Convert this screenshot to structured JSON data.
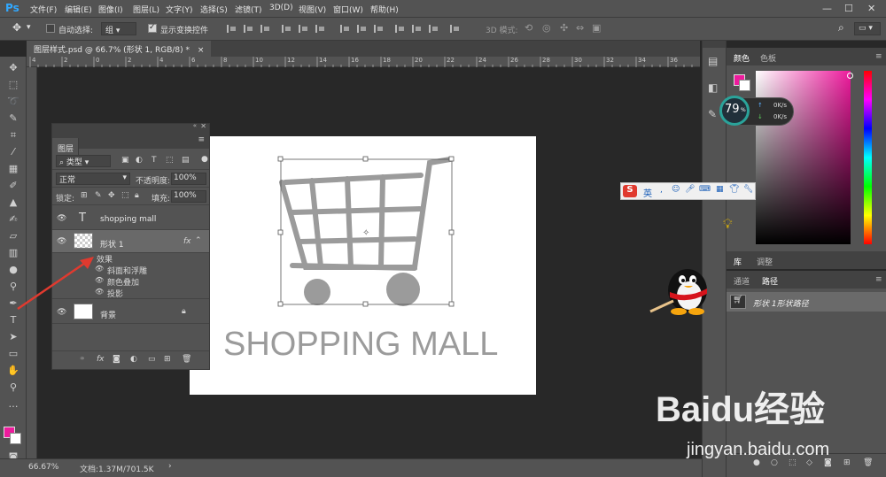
{
  "app": {
    "logo": "Ps"
  },
  "menu": [
    "文件(F)",
    "编辑(E)",
    "图像(I)",
    "图层(L)",
    "文字(Y)",
    "选择(S)",
    "滤镜(T)",
    "3D(D)",
    "视图(V)",
    "窗口(W)",
    "帮助(H)"
  ],
  "window_controls": {
    "minimize": "—",
    "maximize": "☐",
    "close": "✕"
  },
  "options": {
    "auto_select_label": "自动选择:",
    "auto_select_value": "组",
    "show_transform_label": "显示变换控件",
    "mode_3d_label": "3D 模式:"
  },
  "document": {
    "tab_title": "图层样式.psd @ 66.7% (形状 1, RGB/8) *",
    "close_glyph": "×"
  },
  "canvas": {
    "text": "SHOPPING MALL"
  },
  "layers_panel": {
    "tab": "图层",
    "filter": "类型",
    "blend_mode": "正常",
    "opacity_label": "不透明度:",
    "opacity_value": "100%",
    "lock_label": "锁定:",
    "fill_label": "填充:",
    "fill_value": "100%",
    "layers": [
      {
        "name": "shopping mall",
        "kind": "text",
        "thumb": "T"
      },
      {
        "name": "形状 1",
        "kind": "shape",
        "fx": "fx"
      },
      {
        "name": "背景",
        "kind": "background"
      }
    ],
    "effects_label": "效果",
    "effects": [
      "斜面和浮雕",
      "颜色叠加",
      "投影"
    ]
  },
  "color_panel": {
    "tabs": [
      "颜色",
      "色板"
    ],
    "fg": "#ee1b9d",
    "bg": "#ffffff"
  },
  "lib_panel": {
    "tabs": [
      "库",
      "调整"
    ]
  },
  "paths_panel": {
    "tabs": [
      "通道",
      "路径"
    ],
    "path_name": "形状 1形状路径"
  },
  "speed_widget": {
    "percent": "79",
    "percent_sign": "%",
    "up": "0K/s",
    "down": "0K/s"
  },
  "ime_bar": {
    "label": "英"
  },
  "status": {
    "zoom": "66.67%",
    "doc_info": "文档:1.37M/701.5K"
  },
  "watermark": {
    "logo": "Baidu经验",
    "url": "jingyan.baidu.com"
  },
  "ruler_top_labels": [
    "4",
    "2",
    "0",
    "2",
    "4",
    "6",
    "8",
    "10",
    "12",
    "14",
    "16",
    "18",
    "20",
    "22",
    "24",
    "26",
    "28",
    "30",
    "32",
    "34",
    "36"
  ],
  "colors": {
    "accent": "#ee1b9d",
    "ps_blue": "#31a8ff",
    "panel": "#535353",
    "dark": "#282828"
  }
}
